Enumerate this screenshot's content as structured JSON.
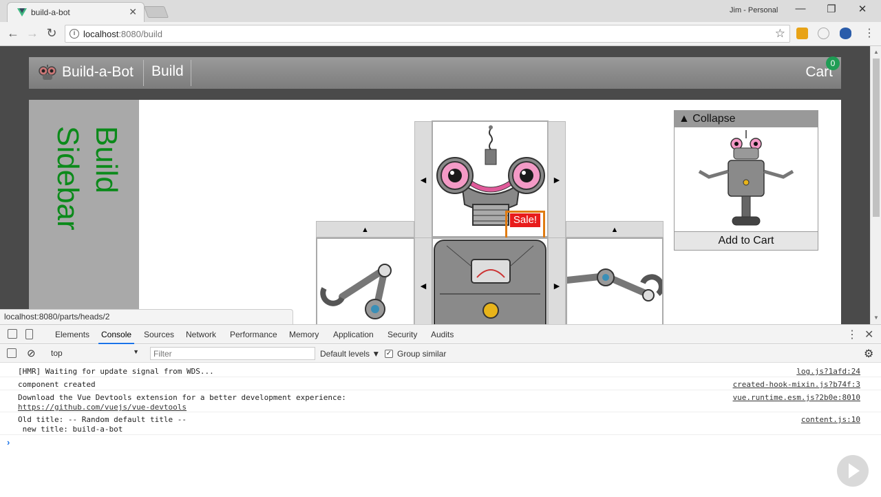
{
  "browser": {
    "tab_title": "build-a-bot",
    "tab_close": "✕",
    "profile_name": "Jim - Personal",
    "url_host": "localhost",
    "url_path": ":8080/build",
    "status_url": "localhost:8080/parts/heads/2"
  },
  "app": {
    "brand": "Build-a-Bot",
    "nav_build": "Build",
    "cart_label": "Cart",
    "cart_count": "0",
    "sidebar_text": "Build\nSidebar",
    "sale_label": "Sale!",
    "arrow_left": "◀",
    "arrow_right": "▶",
    "arrow_up": "▲",
    "preview": {
      "collapse_label": "▲ Collapse",
      "add_to_cart": "Add to Cart"
    }
  },
  "devtools": {
    "tabs": [
      "Elements",
      "Console",
      "Sources",
      "Network",
      "Performance",
      "Memory",
      "Application",
      "Security",
      "Audits"
    ],
    "active_tab": "Console",
    "context": "top",
    "filter_placeholder": "Filter",
    "levels": "Default levels ▼",
    "group_similar": "Group similar",
    "logs": [
      {
        "message": "[HMR] Waiting for update signal from WDS...",
        "source": "log.js?1afd:24"
      },
      {
        "message": "component created",
        "source": "created-hook-mixin.js?b74f:3"
      },
      {
        "message": "Download the Vue Devtools extension for a better development experience:",
        "link": "https://github.com/vuejs/vue-devtools",
        "source": "vue.runtime.esm.js?2b0e:8010"
      },
      {
        "message": "Old title: -- Random default title --\n new title: build-a-bot",
        "source": "content.js:10"
      }
    ],
    "prompt": "›"
  },
  "colors": {
    "sidebar_text": "#0b8a1a",
    "sale_bg": "#e81c1c",
    "highlight": "#e07b12",
    "cart_badge": "#1f9d55"
  },
  "icons": [
    "back-icon",
    "forward-icon",
    "reload-icon",
    "info-icon",
    "star-icon",
    "menu-icon",
    "inspect-icon",
    "device-icon",
    "settings-icon",
    "clear-console-icon",
    "sidebar-toggle-icon"
  ]
}
